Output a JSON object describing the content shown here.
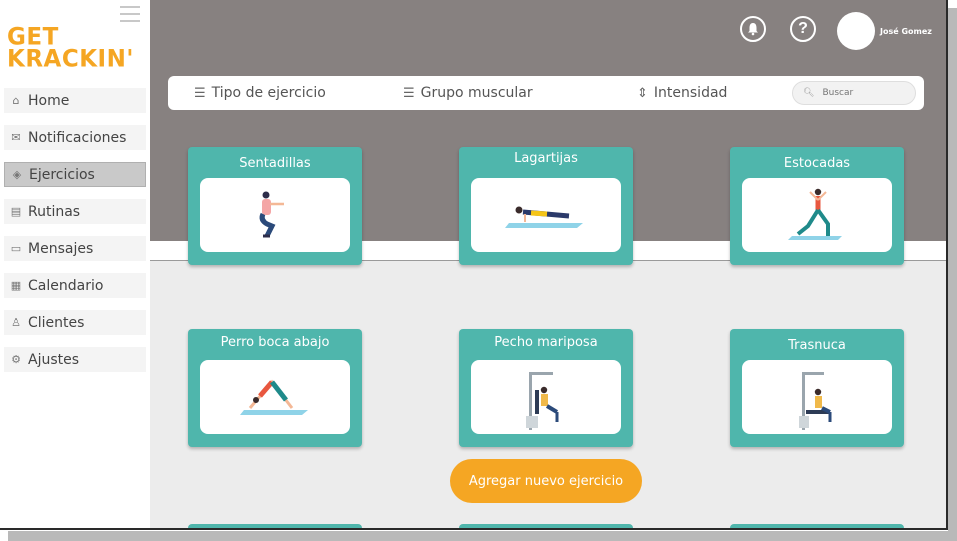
{
  "brand": {
    "line1": "GET",
    "line2": "KRACKIN'"
  },
  "sidebar": {
    "items": [
      {
        "label": "Home",
        "icon": "home-icon",
        "glyph": "⌂"
      },
      {
        "label": "Notificaciones",
        "icon": "mail-icon",
        "glyph": "✉"
      },
      {
        "label": "Ejercicios",
        "icon": "exercise-icon",
        "glyph": "◈",
        "active": true
      },
      {
        "label": "Rutinas",
        "icon": "document-icon",
        "glyph": "▤"
      },
      {
        "label": "Mensajes",
        "icon": "chat-icon",
        "glyph": "▭"
      },
      {
        "label": "Calendario",
        "icon": "calendar-icon",
        "glyph": "▦"
      },
      {
        "label": "Clientes",
        "icon": "user-icon",
        "glyph": "♙"
      },
      {
        "label": "Ajustes",
        "icon": "gear-icon",
        "glyph": "⚙"
      }
    ]
  },
  "header": {
    "user_name": "José Gomez",
    "bell_glyph": "🔔",
    "help_glyph": "?"
  },
  "filters": {
    "tipo": "Tipo de ejercicio",
    "grupo": "Grupo muscular",
    "intensidad": "Intensidad",
    "search_placeholder": "Buscar"
  },
  "exercises": [
    "Sentadillas",
    "Lagartijas",
    "Estocadas",
    "Perro boca abajo",
    "Pecho mariposa",
    "Trasnuca"
  ],
  "add_button": "Agregar nuevo ejercicio",
  "colors": {
    "accent": "#f5a623",
    "card": "#4fb6ac",
    "header": "#878180"
  }
}
